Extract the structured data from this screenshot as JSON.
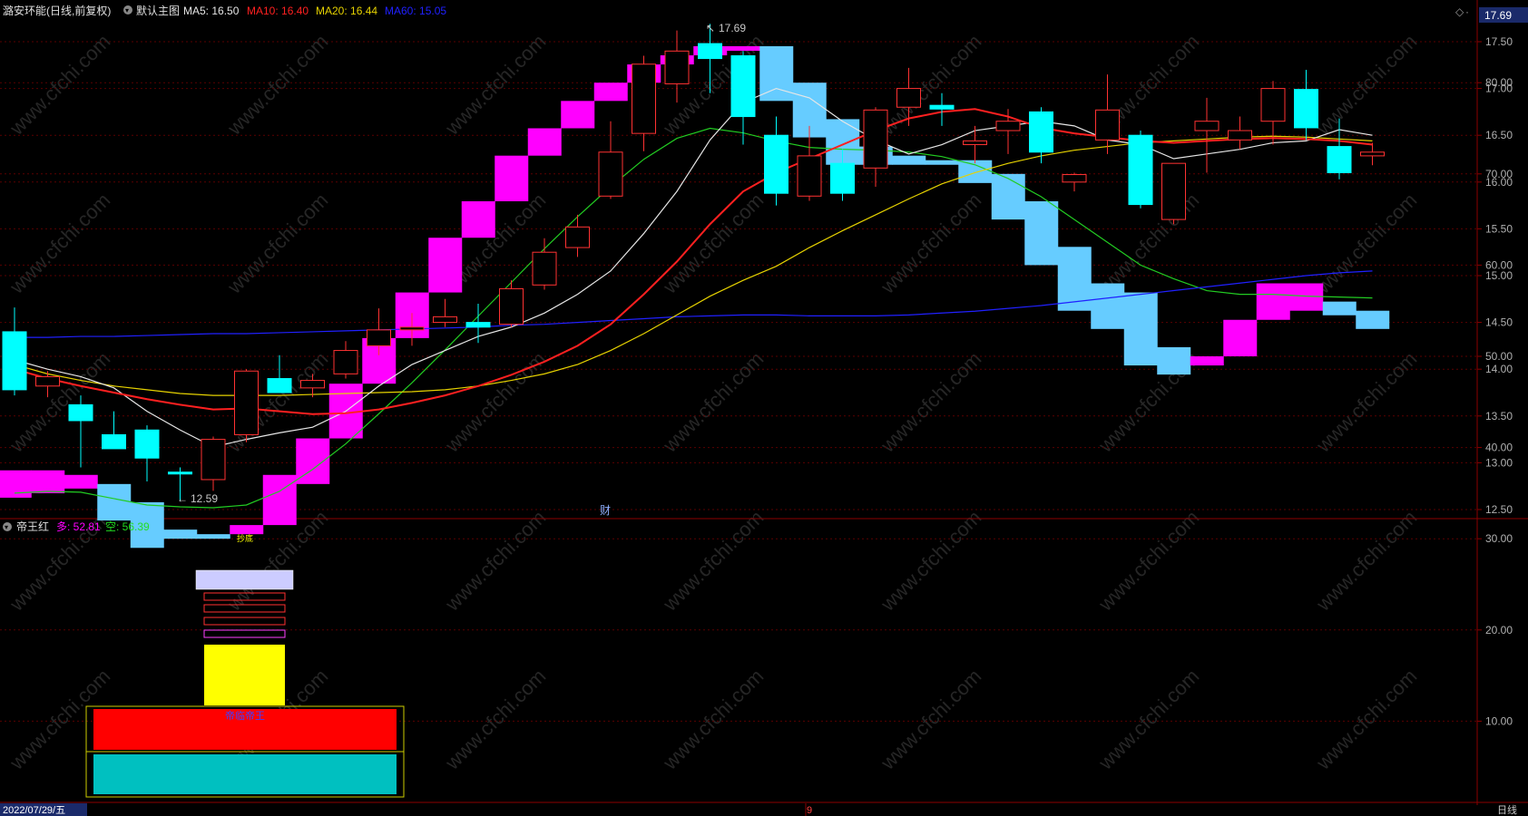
{
  "header": {
    "stock_title": "潞安环能(日线,前复权)",
    "template_label": "默认主图",
    "ma5_label": "MA5: 16.50",
    "ma10_label": "MA10: 16.40",
    "ma20_label": "MA20: 16.44",
    "ma60_label": "MA60: 15.05",
    "last_price": "17.69"
  },
  "indicator_header": {
    "name": "帝王红",
    "long_label": "多: 52.81",
    "short_label": "空: 56.39",
    "small_label": "抄底",
    "strip_label": "帝临帝王"
  },
  "footer": {
    "date": "2022/07/29/五",
    "month_mark": "9",
    "period": "日线"
  },
  "annotations": {
    "high_label": "17.69",
    "low_label": "12.59",
    "cai_label": "财"
  },
  "watermark": "www.cfchi.com",
  "colors": {
    "up": "#ff3232",
    "down": "#00ffff",
    "ma5": "#e6e6e6",
    "ma10": "#ff2020",
    "ma20": "#e6d200",
    "ma60": "#2020ff",
    "magenta": "#ff00ff",
    "lightblue": "#66ccff",
    "green_line": "#22cc22"
  },
  "chart_data": [
    {
      "type": "candlestick",
      "ylim": [
        12.3,
        17.9
      ],
      "yticks": [
        12.5,
        13.0,
        13.5,
        14.0,
        14.5,
        15.0,
        15.5,
        16.0,
        16.5,
        17.0,
        17.5
      ],
      "candles": [
        [
          14.4,
          14.66,
          13.72,
          13.78
        ],
        [
          13.82,
          13.98,
          13.7,
          13.92
        ],
        [
          13.62,
          13.72,
          12.95,
          13.45
        ],
        [
          13.3,
          13.55,
          13.22,
          13.15
        ],
        [
          13.35,
          13.4,
          12.8,
          13.05
        ],
        [
          12.9,
          12.95,
          12.59,
          12.88
        ],
        [
          12.82,
          13.28,
          12.7,
          13.25
        ],
        [
          13.3,
          14.0,
          13.22,
          13.98
        ],
        [
          13.9,
          14.15,
          13.75,
          13.75
        ],
        [
          13.8,
          13.95,
          13.7,
          13.88
        ],
        [
          13.95,
          14.3,
          13.9,
          14.2
        ],
        [
          14.25,
          14.65,
          14.15,
          14.42
        ],
        [
          14.42,
          14.6,
          14.25,
          14.45
        ],
        [
          14.5,
          14.75,
          14.45,
          14.56
        ],
        [
          14.5,
          14.7,
          14.28,
          14.45
        ],
        [
          14.48,
          14.95,
          14.45,
          14.86
        ],
        [
          14.9,
          15.4,
          14.85,
          15.25
        ],
        [
          15.3,
          15.65,
          15.2,
          15.52
        ],
        [
          15.85,
          16.65,
          15.82,
          16.32
        ],
        [
          16.52,
          17.35,
          16.33,
          17.26
        ],
        [
          17.05,
          17.62,
          16.85,
          17.4
        ],
        [
          17.48,
          17.69,
          16.95,
          17.32
        ],
        [
          17.35,
          17.4,
          16.4,
          16.7
        ],
        [
          16.5,
          16.7,
          15.75,
          15.88
        ],
        [
          15.85,
          16.6,
          15.8,
          16.28
        ],
        [
          16.2,
          16.35,
          15.8,
          15.88
        ],
        [
          16.15,
          16.8,
          15.95,
          16.77
        ],
        [
          16.8,
          17.22,
          16.6,
          17.0
        ],
        [
          16.82,
          16.95,
          16.6,
          16.78
        ],
        [
          16.4,
          16.6,
          16.2,
          16.44
        ],
        [
          16.55,
          16.78,
          16.3,
          16.65
        ],
        [
          16.75,
          16.8,
          16.2,
          16.32
        ],
        [
          16.0,
          16.1,
          15.9,
          16.08
        ],
        [
          16.45,
          17.15,
          16.3,
          16.77
        ],
        [
          16.5,
          16.55,
          15.72,
          15.76
        ],
        [
          15.6,
          16.2,
          15.55,
          16.2
        ],
        [
          16.55,
          16.9,
          16.1,
          16.65
        ],
        [
          16.45,
          16.7,
          16.35,
          16.55
        ],
        [
          16.65,
          17.08,
          16.4,
          17.0
        ],
        [
          16.99,
          17.2,
          16.45,
          16.58
        ],
        [
          16.38,
          16.68,
          16.03,
          16.1
        ],
        [
          16.28,
          16.42,
          16.18,
          16.32
        ]
      ],
      "ma5": [
        14.1,
        14.0,
        13.92,
        13.8,
        13.55,
        13.35,
        13.17,
        13.25,
        13.32,
        13.38,
        13.55,
        13.82,
        14.05,
        14.2,
        14.35,
        14.45,
        14.6,
        14.8,
        15.05,
        15.45,
        15.9,
        16.45,
        16.85,
        17.0,
        16.9,
        16.65,
        16.45,
        16.3,
        16.4,
        16.55,
        16.6,
        16.65,
        16.6,
        16.45,
        16.4,
        16.25,
        16.3,
        16.35,
        16.42,
        16.44,
        16.56,
        16.5
      ],
      "ma10": [
        14.0,
        13.9,
        13.82,
        13.75,
        13.68,
        13.62,
        13.57,
        13.58,
        13.55,
        13.52,
        13.53,
        13.57,
        13.64,
        13.72,
        13.82,
        13.94,
        14.08,
        14.25,
        14.48,
        14.8,
        15.15,
        15.55,
        15.9,
        16.1,
        16.25,
        16.4,
        16.55,
        16.68,
        16.75,
        16.78,
        16.7,
        16.58,
        16.52,
        16.48,
        16.44,
        16.42,
        16.44,
        16.46,
        16.47,
        16.46,
        16.44,
        16.4
      ],
      "ma20": [
        14.05,
        13.95,
        13.88,
        13.82,
        13.78,
        13.74,
        13.72,
        13.72,
        13.72,
        13.73,
        13.74,
        13.75,
        13.76,
        13.78,
        13.82,
        13.88,
        13.95,
        14.05,
        14.2,
        14.38,
        14.58,
        14.78,
        14.95,
        15.1,
        15.3,
        15.48,
        15.65,
        15.82,
        15.98,
        16.1,
        16.2,
        16.28,
        16.34,
        16.38,
        16.42,
        16.44,
        16.46,
        16.48,
        16.49,
        16.48,
        16.46,
        16.44
      ],
      "ma60": [
        14.34,
        14.34,
        14.35,
        14.35,
        14.36,
        14.37,
        14.38,
        14.38,
        14.39,
        14.4,
        14.41,
        14.42,
        14.43,
        14.44,
        14.45,
        14.47,
        14.48,
        14.5,
        14.52,
        14.54,
        14.56,
        14.57,
        14.58,
        14.58,
        14.57,
        14.57,
        14.57,
        14.58,
        14.6,
        14.62,
        14.65,
        14.68,
        14.72,
        14.76,
        14.8,
        14.84,
        14.88,
        14.92,
        14.96,
        15.0,
        15.03,
        15.05
      ]
    },
    {
      "type": "bar",
      "title": "帝王红",
      "ylim": [
        0,
        88
      ],
      "yticks": [
        10,
        20,
        30,
        40,
        50,
        60,
        70,
        80
      ],
      "steps": [
        [
          34.5,
          37.5
        ],
        [
          35,
          37.5
        ],
        [
          35.5,
          37
        ],
        [
          32,
          36
        ],
        [
          29,
          34
        ],
        [
          30,
          31
        ],
        [
          30,
          30.5
        ],
        [
          30.5,
          31.5
        ],
        [
          31.5,
          37
        ],
        [
          36,
          41
        ],
        [
          41,
          47
        ],
        [
          47,
          52
        ],
        [
          52,
          57
        ],
        [
          57,
          63
        ],
        [
          63,
          67
        ],
        [
          67,
          72
        ],
        [
          72,
          75
        ],
        [
          75,
          78
        ],
        [
          78,
          80
        ],
        [
          80,
          82
        ],
        [
          82,
          83
        ],
        [
          83,
          84
        ],
        [
          83.5,
          84
        ],
        [
          78,
          84
        ],
        [
          74,
          80
        ],
        [
          71,
          76
        ],
        [
          71,
          73
        ],
        [
          71,
          72
        ],
        [
          71,
          71.5
        ],
        [
          69,
          71.5
        ],
        [
          65,
          70
        ],
        [
          60,
          67
        ],
        [
          55,
          62
        ],
        [
          53,
          58
        ],
        [
          49,
          57
        ],
        [
          48,
          51
        ],
        [
          49,
          50
        ],
        [
          50,
          54
        ],
        [
          54,
          58
        ],
        [
          55,
          58
        ],
        [
          54.5,
          56
        ],
        [
          53,
          55
        ]
      ],
      "green_line": [
        35,
        35.2,
        35.1,
        34.4,
        33.7,
        33.5,
        33.4,
        33.7,
        35.2,
        37.6,
        40.4,
        43.7,
        47.1,
        50.7,
        54.4,
        58.1,
        61.8,
        65.3,
        68.6,
        71.6,
        73.9,
        75.0,
        74.5,
        73.6,
        72.9,
        72.7,
        72.6,
        72.4,
        71.9,
        71.0,
        69.5,
        67.5,
        65.0,
        62.5,
        60.0,
        58.5,
        57.2,
        56.8,
        56.8,
        56.6,
        56.5,
        56.4
      ]
    }
  ]
}
